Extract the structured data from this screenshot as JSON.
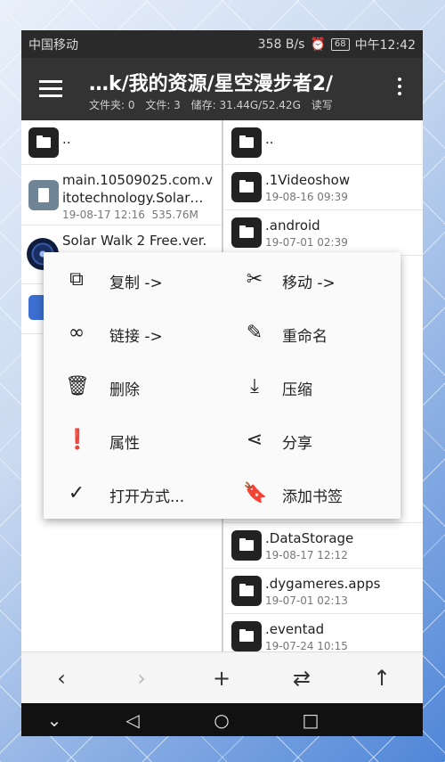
{
  "status_bar": {
    "carrier": "中国移动",
    "speed": "358 B/s",
    "battery": "68",
    "time": "中午12:42"
  },
  "app_bar": {
    "title": "…k/我的资源/星空漫步者2/",
    "folders": "文件夹: 0",
    "files": "文件: 3",
    "storage": "储存: 31.44G/52.42G",
    "mode": "读写"
  },
  "left_pane": {
    "parent": "..",
    "files": [
      {
        "name_line1": "main.10509025.com.v",
        "name_line2": "itotechnology.Solar…",
        "date": "19-08-17 12:16",
        "size": "535.76M"
      },
      {
        "name_line1": "Solar Walk 2 Free.ver."
      }
    ]
  },
  "right_pane": {
    "parent": "..",
    "folders": [
      {
        "name": ".1Videoshow",
        "date": "19-08-16 09:39"
      },
      {
        "name": ".android",
        "date": "19-07-01 02:39"
      },
      {
        "name": ".DataStorage",
        "date": "19-08-17 12:12"
      },
      {
        "name": ".dygameres.apps",
        "date": "19-07-01 02:13"
      },
      {
        "name": ".eventad",
        "date": "19-07-24 10:15"
      }
    ]
  },
  "context_menu": {
    "copy": "复制 ->",
    "move": "移动 ->",
    "link": "链接 ->",
    "rename": "重命名",
    "delete": "删除",
    "compress": "压缩",
    "properties": "属性",
    "share": "分享",
    "open_with": "打开方式...",
    "add_bookmark": "添加书签"
  }
}
